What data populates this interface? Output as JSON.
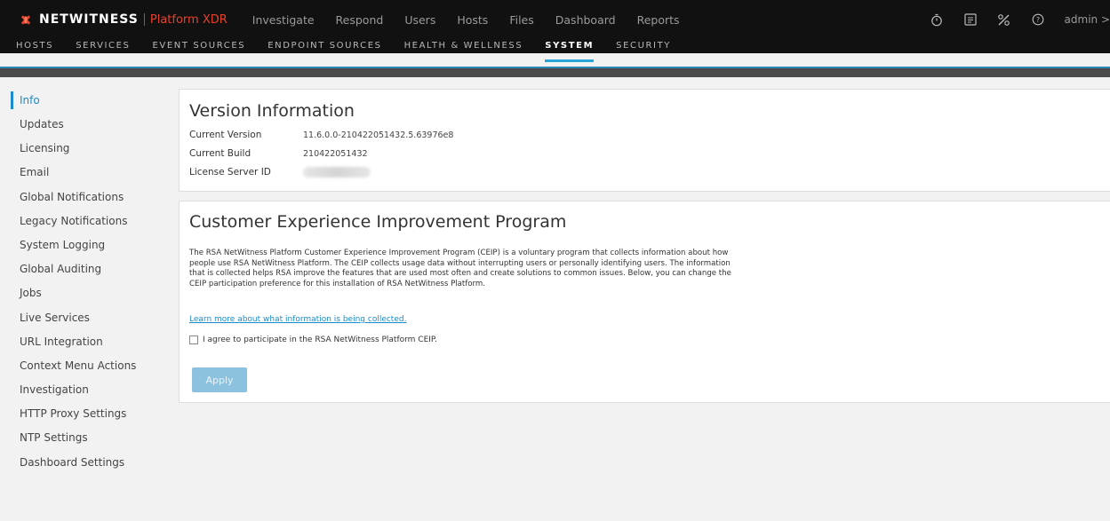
{
  "brand": {
    "name": "NETWITNESS",
    "product": "Platform XDR",
    "accent_color": "#e8412b"
  },
  "top_nav": [
    "Investigate",
    "Respond",
    "Users",
    "Hosts",
    "Files",
    "Dashboard",
    "Reports"
  ],
  "toolbar": {
    "icons": [
      "stopwatch-icon",
      "tasks-icon",
      "admin-tools-icon",
      "help-icon"
    ],
    "user_label": "admin >"
  },
  "sub_nav": {
    "items": [
      "HOSTS",
      "SERVICES",
      "EVENT SOURCES",
      "ENDPOINT SOURCES",
      "HEALTH & WELLNESS",
      "SYSTEM",
      "SECURITY"
    ],
    "active": "SYSTEM",
    "active_color": "#2aa4d8"
  },
  "sidebar": {
    "items": [
      "Info",
      "Updates",
      "Licensing",
      "Email",
      "Global Notifications",
      "Legacy Notifications",
      "System Logging",
      "Global Auditing",
      "Jobs",
      "Live Services",
      "URL Integration",
      "Context Menu Actions",
      "Investigation",
      "HTTP Proxy Settings",
      "NTP Settings",
      "Dashboard Settings"
    ],
    "active": "Info"
  },
  "version_info": {
    "title": "Version Information",
    "rows": [
      {
        "label": "Current Version",
        "value": "11.6.0.0-210422051432.5.63976e8"
      },
      {
        "label": "Current Build",
        "value": "210422051432"
      },
      {
        "label": "License Server ID",
        "value": ""
      }
    ]
  },
  "ceip": {
    "title": "Customer Experience Improvement Program",
    "paragraph": "The RSA NetWitness Platform Customer Experience Improvement Program (CEIP) is a voluntary program that collects information about how people use RSA NetWitness Platform. The CEIP collects usage data without interrupting users or personally identifying users. The information that is collected helps RSA improve the features that are used most often and create solutions to common issues. Below, you can change the CEIP participation preference for this installation of RSA NetWitness Platform.",
    "learn_more_link": "Learn more about what information is being collected.",
    "agree_label": "I agree to participate in the RSA NetWitness Platform CEIP.",
    "agree_checked": false,
    "apply_label": "Apply"
  }
}
